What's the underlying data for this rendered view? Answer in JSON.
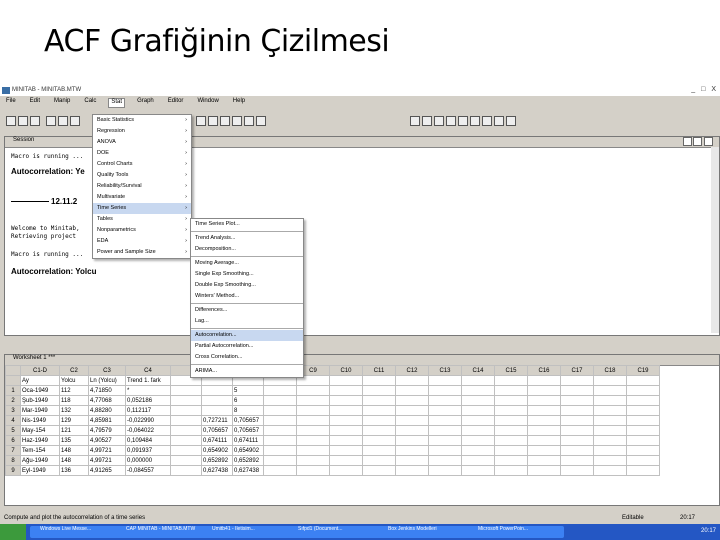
{
  "slide": {
    "title": "ACF Grafiğinin Çizilmesi"
  },
  "app": {
    "title": "MINITAB - MINITAB.MTW",
    "window_controls": [
      "_",
      "□",
      "X"
    ],
    "menu": [
      "File",
      "Edit",
      "Manip",
      "Calc",
      "Stat",
      "Graph",
      "Editor",
      "Window",
      "Help"
    ],
    "active_menu": "Stat"
  },
  "session": {
    "title": "Session",
    "lines": [
      {
        "text": "Macro is running ...",
        "style": "mono"
      },
      {
        "text": "Autocorrelation: Ye",
        "style": "bold"
      },
      {
        "text": "12.11.2",
        "style": "bold"
      },
      {
        "text": "Welcome to Minitab,",
        "style": "mono"
      },
      {
        "text": "Retrieving project",
        "style": "mono"
      },
      {
        "text": "Macro is running ...",
        "style": "mono"
      },
      {
        "text": "Autocorrelation: Yolcu",
        "style": "bold"
      }
    ]
  },
  "stat_menu": {
    "items": [
      {
        "label": "Basic Statistics",
        "sub": true
      },
      {
        "label": "Regression",
        "sub": true
      },
      {
        "label": "ANOVA",
        "sub": true
      },
      {
        "label": "DOE",
        "sub": true
      },
      {
        "label": "Control Charts",
        "sub": true
      },
      {
        "label": "Quality Tools",
        "sub": true
      },
      {
        "label": "Reliability/Survival",
        "sub": true
      },
      {
        "label": "Multivariate",
        "sub": true
      },
      {
        "label": "Time Series",
        "sub": true,
        "highlight": true
      },
      {
        "label": "Tables",
        "sub": true
      },
      {
        "label": "Nonparametrics",
        "sub": true
      },
      {
        "label": "EDA",
        "sub": true
      },
      {
        "label": "Power and Sample Size",
        "sub": true
      }
    ]
  },
  "timeseries_menu": {
    "items": [
      {
        "label": "Time Series Plot..."
      },
      {
        "sep": true
      },
      {
        "label": "Trend Analysis..."
      },
      {
        "label": "Decomposition..."
      },
      {
        "sep": true
      },
      {
        "label": "Moving Average..."
      },
      {
        "label": "Single Exp Smoothing..."
      },
      {
        "label": "Double Exp Smoothing..."
      },
      {
        "label": "Winters' Method..."
      },
      {
        "sep": true
      },
      {
        "label": "Differences..."
      },
      {
        "label": "Lag..."
      },
      {
        "sep": true
      },
      {
        "label": "Autocorrelation...",
        "highlight": true
      },
      {
        "label": "Partial Autocorrelation..."
      },
      {
        "label": "Cross Correlation..."
      },
      {
        "sep": true
      },
      {
        "label": "ARIMA..."
      }
    ]
  },
  "worksheet": {
    "title": "Worksheet 1 ***",
    "columns": [
      "C1-D",
      "C2",
      "C3",
      "C4",
      "",
      "",
      "",
      "C8",
      "C9",
      "C10",
      "C11",
      "C12",
      "C13",
      "C14",
      "C15",
      "C16",
      "C17",
      "C18",
      "C19"
    ],
    "names": [
      "Ay",
      "Yolcu",
      "Ln (Yolcu)",
      "Trend 1. fark",
      "",
      "",
      "",
      "",
      "",
      "",
      "",
      "",
      "",
      "",
      "",
      "",
      "",
      "",
      ""
    ],
    "rows": [
      [
        "1",
        "Oca-1949",
        "112",
        "4,71850",
        "*",
        "",
        "",
        "5"
      ],
      [
        "2",
        "Şub-1949",
        "118",
        "4,77068",
        "0,052186",
        "",
        "",
        "6"
      ],
      [
        "3",
        "Mar-1949",
        "132",
        "4,88280",
        "0,112117",
        "",
        "",
        "8"
      ],
      [
        "4",
        "Nis-1949",
        "129",
        "4,85981",
        "-0,022990",
        "",
        "0,727211",
        "0,705657"
      ],
      [
        "5",
        "May-154",
        "121",
        "4,79579",
        "-0,064022",
        "",
        "0,705657",
        "0,705657"
      ],
      [
        "6",
        "Haz-1949",
        "135",
        "4,90527",
        "0,109484",
        "",
        "0,674111",
        "0,674111"
      ],
      [
        "7",
        "Tem-154",
        "148",
        "4,99721",
        "0,091937",
        "",
        "0,654902",
        "0,654902"
      ],
      [
        "8",
        "Ağu-1949",
        "148",
        "4,99721",
        "0,000000",
        "",
        "0,652892",
        "0,652892"
      ],
      [
        "9",
        "Eyl-1949",
        "136",
        "4,91265",
        "-0,084557",
        "",
        "0,627438",
        "0,627438"
      ]
    ]
  },
  "status": {
    "left": "Compute and plot the autocorrelation of a time series",
    "right": "Editable",
    "time": "20:17"
  },
  "taskbar": {
    "tasks": [
      "Windows Live Messe...",
      "CAP MİNİTAB - MINITAB.MTW",
      "Umitb41 - Iletisim...",
      "Sıfpd1 (Document...",
      "Box Jenkins Modelleri",
      "Microsoft PowerPoin..."
    ],
    "clock": "20:17"
  }
}
